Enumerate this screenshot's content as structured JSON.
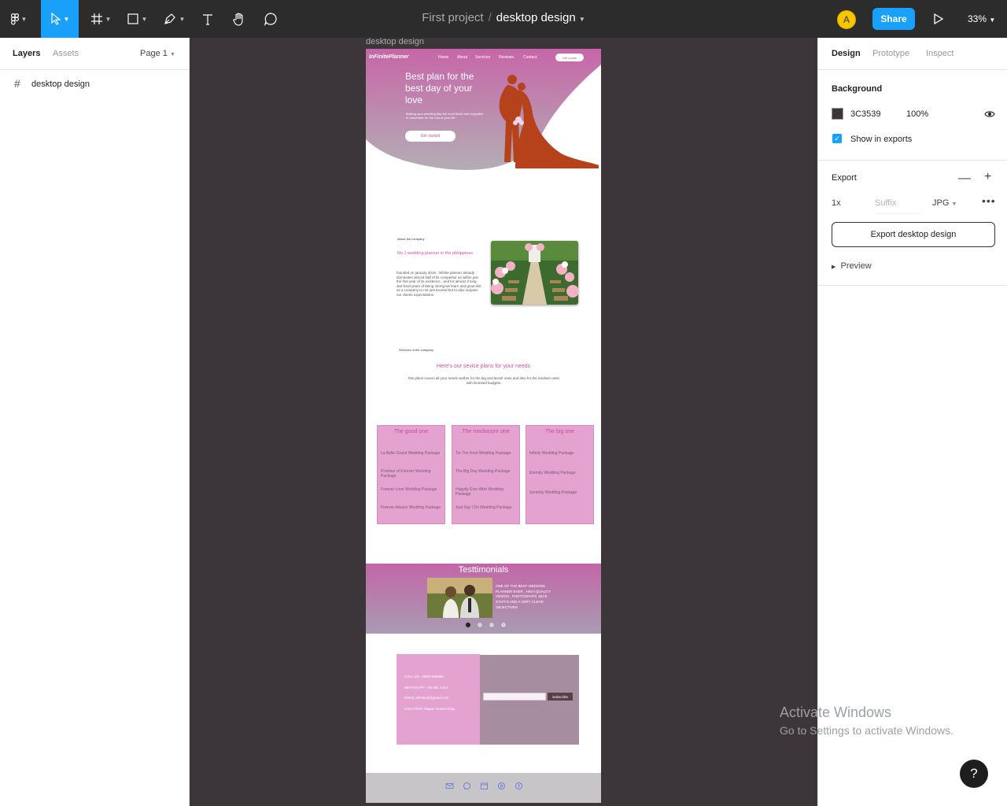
{
  "toolbar": {
    "tools": [
      "main-menu",
      "move-tool",
      "frame-tool",
      "shape-tool",
      "pen-tool",
      "text-tool",
      "hand-tool",
      "comment-tool"
    ],
    "project_name": "First project",
    "separator": "/",
    "file_name": "desktop design",
    "avatar_initial": "A",
    "share_label": "Share",
    "zoom": "33%"
  },
  "left_panel": {
    "tab_layers": "Layers",
    "tab_assets": "Assets",
    "page": "Page 1",
    "layers": [
      {
        "name": "desktop design"
      }
    ]
  },
  "canvas": {
    "frame_label": "desktop design",
    "design": {
      "logo": "InFinitePlanner",
      "nav": [
        "Home",
        "About",
        "Services",
        "Reviews",
        "Contact"
      ],
      "nav_cta": "Get a plan",
      "hero_title": "Best plan for the best day of your love",
      "hero_sub": "Making your wedding day the most finest and enjoyable to remember for the rest of your life.",
      "hero_cta": "Get started",
      "about_label": "About the company",
      "about_heading": "No.1 wedding planner in the philippines",
      "about_body": "founded on january 2019 , Infinite planner already dominates almost half of its competitor as within just the first year of its existence , and for almost 3 long and hard years of being strong we learn and grow alot as a company to not just exceed but to also surpass our clients expectations.",
      "services_label": "Services of the company",
      "services_heading": "Here's our sevice plans for your needs",
      "services_desc": "this plans covers all your needs wether for the big and lavish ones and also for the medium ones with limmited budgets.",
      "cards": [
        {
          "title": "The good one",
          "items": [
            "La Belle Grand Wedding Package",
            "Promise of Forever Wedding Package",
            "Forever Love Wedding Package",
            "Forever Always Wedding Package"
          ]
        },
        {
          "title": "The mediocore one",
          "items": [
            "Tie The Knot Wedding Package",
            "The Big Day Wedding Package",
            "Happily Ever After Wedding Package",
            "Just Say I Do Wedding Package"
          ]
        },
        {
          "title": "The big one",
          "items": [
            "Infinity Wedding Package",
            "Eternity Wedding Package",
            "Serenity Wedding Package"
          ]
        }
      ],
      "testimonials_title": "Testtimonials",
      "testimonial_text": "ONE OF THE BEST WEDDING PLANNER EVER , HIGH QUALITY VIDEOS , PHOTOGRAPS ,NICE STAFFS AND A VERY CLEAR OBJECTIVES",
      "testimonial_pages": 4,
      "testimonial_active": 1,
      "contacts": [
        "CALL US : 09567896860",
        "WHATSAPP: +36 982 7254",
        "EMAIL:infiniteol@gmail.com",
        "LOCATION: Gapan Nueva Ecija"
      ],
      "subscribe_label": "Subscribe",
      "social_icons": [
        "mail-icon",
        "chat-icon",
        "calendar-icon",
        "instagram-icon",
        "facebook-icon"
      ]
    }
  },
  "right_panel": {
    "tab_design": "Design",
    "tab_prototype": "Prototype",
    "tab_inspect": "Inspect",
    "background_title": "Background",
    "background_hex": "3C3539",
    "background_opacity": "100%",
    "show_in_exports": "Show in exports",
    "export_title": "Export",
    "export_scale": "1x",
    "export_suffix_placeholder": "Suffix",
    "export_format": "JPG",
    "export_button": "Export desktop design",
    "preview": "Preview"
  },
  "windows_watermark": {
    "line1": "Activate Windows",
    "line2": "Go to Settings to activate Windows."
  },
  "help_label": "?",
  "colors": {
    "accent": "#18a0fb",
    "canvas_bg": "#3c3539",
    "brand_pink": "#d24fa4",
    "card_pink": "#e3a2cf"
  }
}
